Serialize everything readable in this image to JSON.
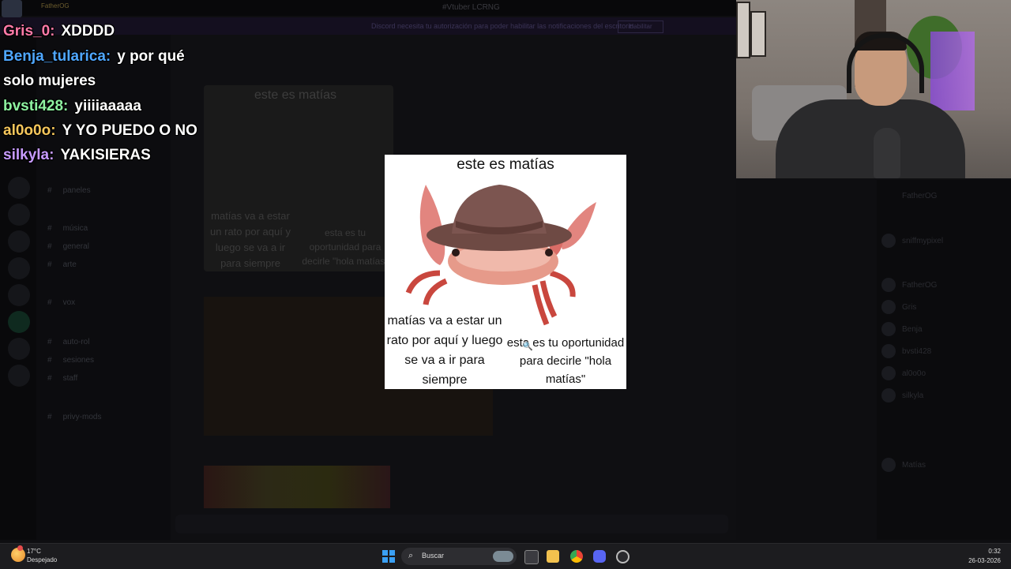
{
  "window": {
    "title": "#Vtuber LCRNG"
  },
  "banner": {
    "text": "Discord necesita tu autorización para poder habilitar las notificaciones del escritorio.",
    "button": "Habilitar"
  },
  "sidebar": {
    "channels": [
      "paneles",
      "música",
      "general",
      "arte",
      "vox",
      "auto-rol",
      "sesiones",
      "staff",
      "privy-mods"
    ]
  },
  "members": [
    "FatherOG",
    "sniffmypixel",
    "FatherOG",
    "Gris",
    "Benja",
    "bvsti428",
    "al0o0o",
    "silkyla",
    "Matías"
  ],
  "chat": {
    "top_user": "FatherOG",
    "messages": [
      {
        "user": "Gris_0",
        "text": "XDDDD",
        "color": "#ff7aa8"
      },
      {
        "user": "Benja_tularica",
        "text": "y por qué",
        "color": "#4fa7ff"
      },
      {
        "user": "",
        "text": "solo mujeres",
        "color": "#ffffff"
      },
      {
        "user": "bvsti428",
        "text": "yiiiiaaaaa",
        "color": "#8ef2a0"
      },
      {
        "user": "al0o0o",
        "text": "Y YO PUEDO O NO",
        "color": "#f6c75c"
      },
      {
        "user": "silkyla",
        "text": "YAKISIERAS",
        "color": "#c79bff"
      }
    ]
  },
  "meme": {
    "title": "este es matías",
    "left_text": "matías va a estar un rato por aquí y luego se va a ir para siempre",
    "right_text": "esta es tu oportunidad para decirle \"hola matías\"",
    "zoom_icon": "zoom-in-icon"
  },
  "ghost_card": {
    "title": "este es matías",
    "left_text": "matías va a estar un rato por aquí y luego se va a ir para siempre",
    "right_text": "esta es tu oportunidad para decirle \"hola matías\""
  },
  "taskbar": {
    "weather_temp": "17°C",
    "weather_cond": "Despejado",
    "search_placeholder": "Buscar",
    "time": "0:32",
    "date": "26-03-2026",
    "icons": [
      "start-icon",
      "search-icon",
      "task-view-icon",
      "file-explorer-icon",
      "chrome-icon",
      "discord-icon",
      "steam-icon"
    ]
  },
  "colors": {
    "background": "#0b0b0d",
    "taskbar": "#1c1c1f",
    "windows_blue": "#3aa0f5",
    "discord": "#5865f2"
  }
}
